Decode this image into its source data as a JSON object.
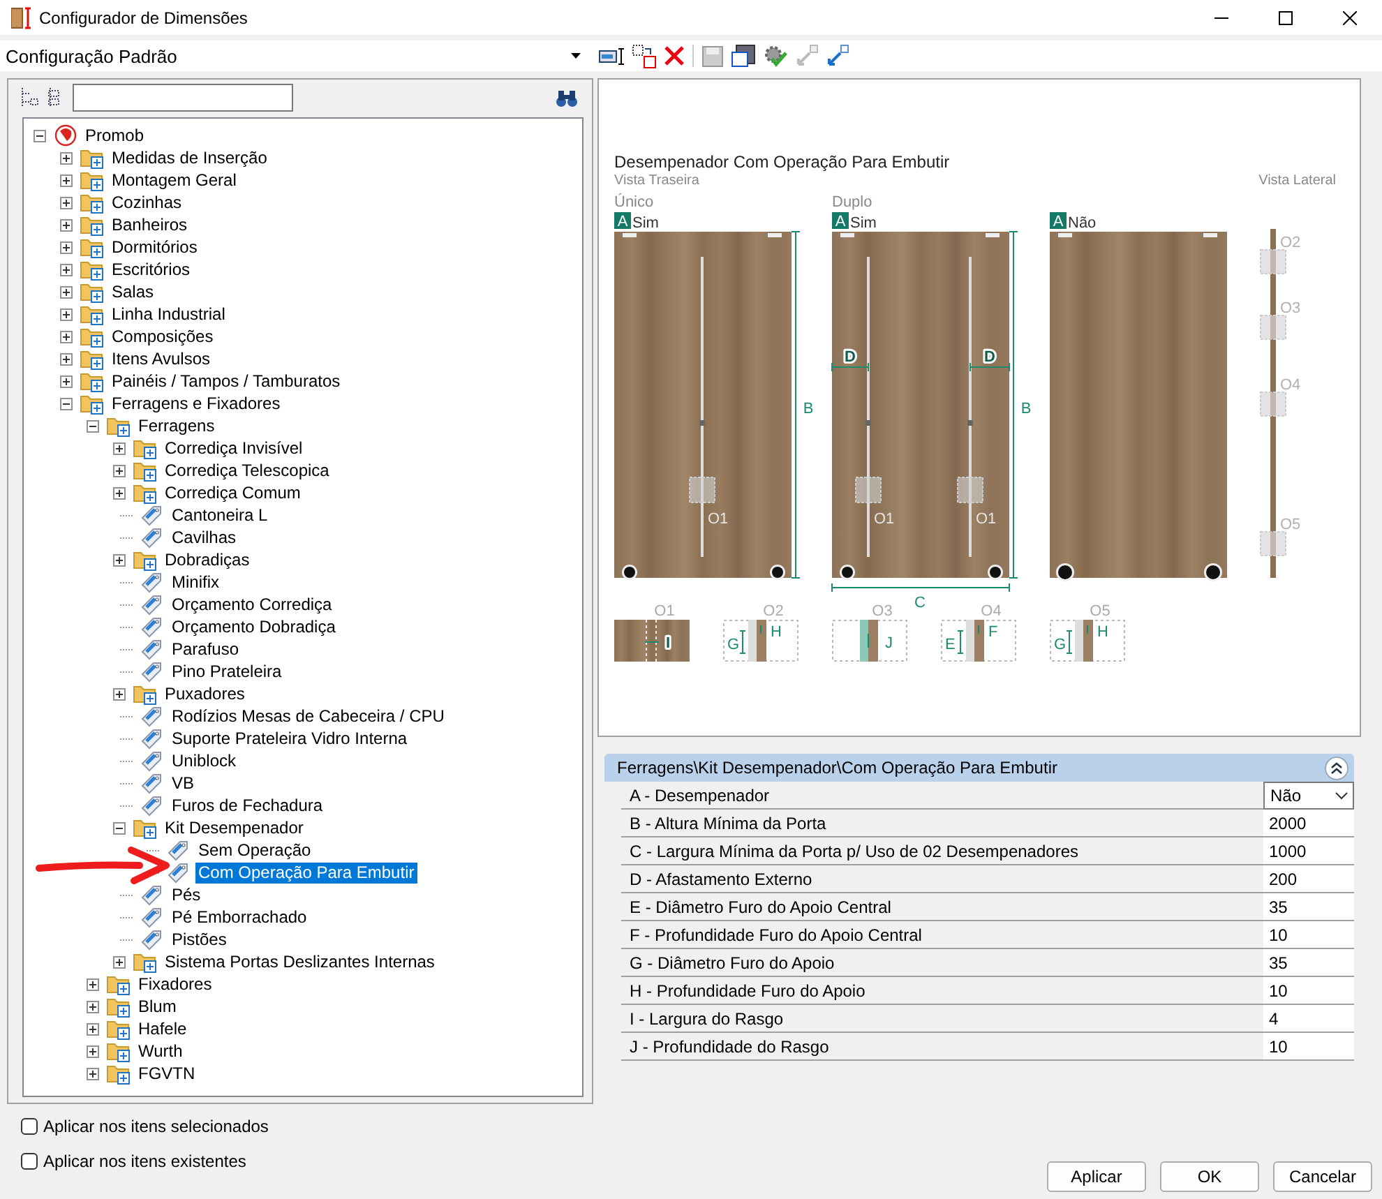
{
  "window": {
    "title": "Configurador de Dimensões"
  },
  "config_select": {
    "value": "Configuração Padrão"
  },
  "tree": [
    {
      "label": "Promob",
      "kind": "root",
      "expanded": true,
      "selected": false,
      "children": [
        {
          "label": "Medidas de Inserção",
          "kind": "folder",
          "expanded": false,
          "selected": false
        },
        {
          "label": "Montagem Geral",
          "kind": "folder",
          "expanded": false,
          "selected": false
        },
        {
          "label": "Cozinhas",
          "kind": "folder",
          "expanded": false,
          "selected": false
        },
        {
          "label": "Banheiros",
          "kind": "folder",
          "expanded": false,
          "selected": false
        },
        {
          "label": "Dormitórios",
          "kind": "folder",
          "expanded": false,
          "selected": false
        },
        {
          "label": "Escritórios",
          "kind": "folder",
          "expanded": false,
          "selected": false
        },
        {
          "label": "Salas",
          "kind": "folder",
          "expanded": false,
          "selected": false
        },
        {
          "label": "Linha Industrial",
          "kind": "folder",
          "expanded": false,
          "selected": false
        },
        {
          "label": "Composições",
          "kind": "folder",
          "expanded": false,
          "selected": false
        },
        {
          "label": "Itens Avulsos",
          "kind": "folder",
          "expanded": false,
          "selected": false
        },
        {
          "label": "Painéis / Tampos / Tamburatos",
          "kind": "folder",
          "expanded": false,
          "selected": false
        },
        {
          "label": "Ferragens e Fixadores",
          "kind": "folder",
          "expanded": true,
          "selected": false,
          "children": [
            {
              "label": "Ferragens",
              "kind": "folder",
              "expanded": true,
              "selected": false,
              "children": [
                {
                  "label": "Corrediça Invisível",
                  "kind": "folder",
                  "expanded": false,
                  "selected": false
                },
                {
                  "label": "Corrediça Telescopica",
                  "kind": "folder",
                  "expanded": false,
                  "selected": false
                },
                {
                  "label": "Corrediça Comum",
                  "kind": "folder",
                  "expanded": false,
                  "selected": false
                },
                {
                  "label": "Cantoneira L",
                  "kind": "item",
                  "selected": false
                },
                {
                  "label": "Cavilhas",
                  "kind": "item",
                  "selected": false
                },
                {
                  "label": "Dobradiças",
                  "kind": "folder",
                  "expanded": false,
                  "selected": false
                },
                {
                  "label": "Minifix",
                  "kind": "item",
                  "selected": false
                },
                {
                  "label": "Orçamento Corrediça",
                  "kind": "item",
                  "selected": false
                },
                {
                  "label": "Orçamento Dobradiça",
                  "kind": "item",
                  "selected": false
                },
                {
                  "label": "Parafuso",
                  "kind": "item",
                  "selected": false
                },
                {
                  "label": "Pino Prateleira",
                  "kind": "item",
                  "selected": false
                },
                {
                  "label": "Puxadores",
                  "kind": "folder",
                  "expanded": false,
                  "selected": false
                },
                {
                  "label": "Rodízios Mesas de Cabeceira / CPU",
                  "kind": "item",
                  "selected": false
                },
                {
                  "label": "Suporte Prateleira Vidro Interna",
                  "kind": "item",
                  "selected": false
                },
                {
                  "label": "Uniblock",
                  "kind": "item",
                  "selected": false
                },
                {
                  "label": "VB",
                  "kind": "item",
                  "selected": false
                },
                {
                  "label": "Furos de Fechadura",
                  "kind": "item",
                  "selected": false
                },
                {
                  "label": "Kit Desempenador",
                  "kind": "folder",
                  "expanded": true,
                  "selected": false,
                  "children": [
                    {
                      "label": "Sem Operação",
                      "kind": "item",
                      "selected": false
                    },
                    {
                      "label": "Com Operação Para Embutir",
                      "kind": "item",
                      "selected": true
                    }
                  ]
                },
                {
                  "label": "Pés",
                  "kind": "item",
                  "selected": false
                },
                {
                  "label": "Pé Emborrachado",
                  "kind": "item",
                  "selected": false
                },
                {
                  "label": "Pistões",
                  "kind": "item",
                  "selected": false
                },
                {
                  "label": "Sistema Portas Deslizantes Internas",
                  "kind": "folder",
                  "expanded": false,
                  "selected": false
                }
              ]
            },
            {
              "label": "Fixadores",
              "kind": "folder",
              "expanded": false,
              "selected": false
            },
            {
              "label": "Blum",
              "kind": "folder",
              "expanded": false,
              "selected": false
            },
            {
              "label": "Hafele",
              "kind": "folder",
              "expanded": false,
              "selected": false
            },
            {
              "label": "Wurth",
              "kind": "folder",
              "expanded": false,
              "selected": false
            },
            {
              "label": "FGVTN",
              "kind": "folder",
              "expanded": false,
              "selected": false
            }
          ]
        }
      ]
    }
  ],
  "options": [
    {
      "label": "Aplicar nos itens selecionados",
      "checked": false
    },
    {
      "label": "Aplicar nos itens existentes",
      "checked": false
    }
  ],
  "diagram": {
    "title": "Desempenador Com Operação Para Embutir",
    "subtitle": "Vista Traseira",
    "side_title": "Vista Lateral",
    "doors": [
      {
        "kind": "single",
        "caption": "Único",
        "badge": "A",
        "option": "Sim",
        "height_label": "B",
        "marker_labels": [
          "O1"
        ]
      },
      {
        "kind": "double",
        "caption": "Duplo",
        "badge": "A",
        "option": "Sim",
        "height_label": "B",
        "width_label": "C",
        "offset_labels": [
          "D",
          "D"
        ],
        "marker_labels": [
          "O1",
          "O1"
        ]
      },
      {
        "kind": "plain",
        "badge": "A",
        "option": "Não"
      }
    ],
    "side_markers": [
      "O2",
      "O3",
      "O4",
      "O5"
    ],
    "details": [
      {
        "kind": "slot",
        "label": "O1",
        "letters": [
          "I"
        ]
      },
      {
        "kind": "hole",
        "label": "O2",
        "letters": [
          "G",
          "H"
        ]
      },
      {
        "kind": "groove",
        "label": "O3",
        "letters": [
          "J"
        ]
      },
      {
        "kind": "hole",
        "label": "O4",
        "letters": [
          "E",
          "F"
        ]
      },
      {
        "kind": "hole",
        "label": "O5",
        "letters": [
          "G",
          "H"
        ]
      }
    ]
  },
  "properties": {
    "path": "Ferragens\\Kit Desempenador\\Com Operação Para Embutir",
    "rows": [
      {
        "label": "A - Desempenador",
        "value": "Não",
        "kind": "select"
      },
      {
        "label": "B - Altura Mínima da Porta",
        "value": "2000",
        "kind": "number"
      },
      {
        "label": "C - Largura Mínima da Porta p/ Uso de 02 Desempenadores",
        "value": "1000",
        "kind": "number"
      },
      {
        "label": "D - Afastamento Externo",
        "value": "200",
        "kind": "number"
      },
      {
        "label": "E - Diâmetro Furo do Apoio Central",
        "value": "35",
        "kind": "number"
      },
      {
        "label": "F - Profundidade Furo do Apoio Central",
        "value": "10",
        "kind": "number"
      },
      {
        "label": "G - Diâmetro Furo do Apoio",
        "value": "35",
        "kind": "number"
      },
      {
        "label": "H - Profundidade Furo do Apoio",
        "value": "10",
        "kind": "number"
      },
      {
        "label": "I - Largura do Rasgo",
        "value": "4",
        "kind": "number"
      },
      {
        "label": "J - Profundidade do Rasgo",
        "value": "10",
        "kind": "number"
      }
    ]
  },
  "buttons": [
    "Aplicar",
    "OK",
    "Cancelar"
  ]
}
